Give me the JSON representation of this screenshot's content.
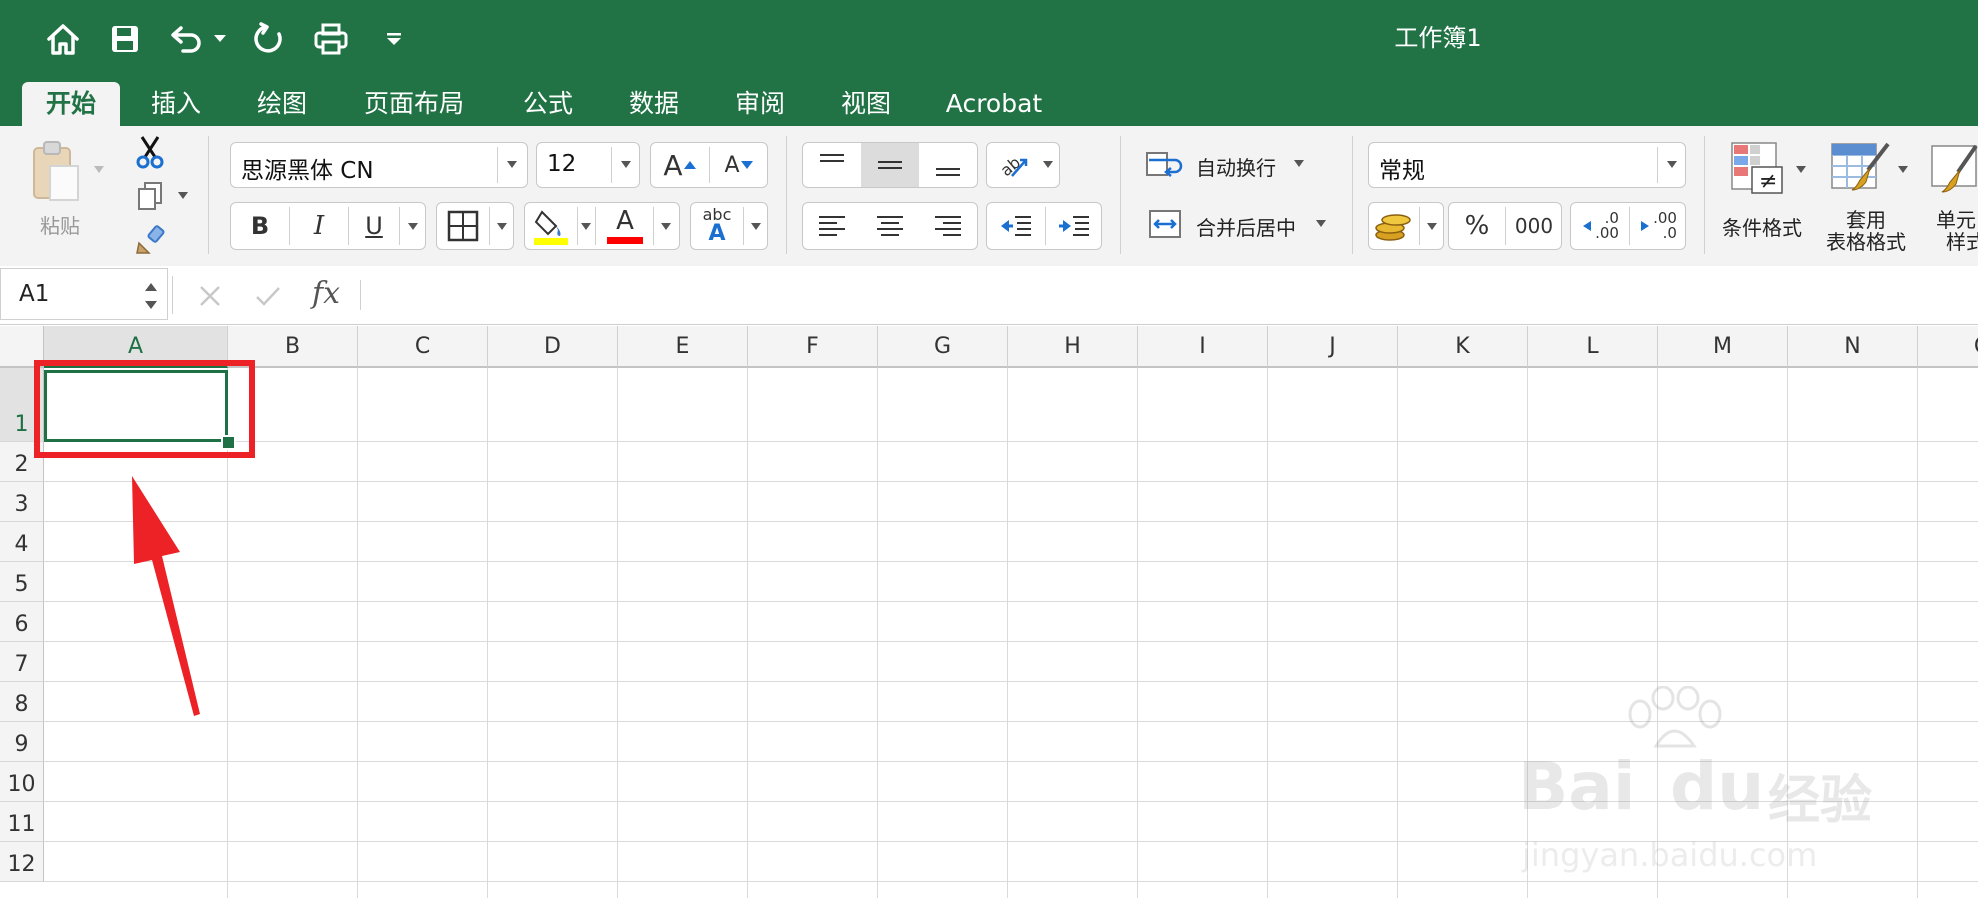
{
  "window": {
    "title": "工作簿1"
  },
  "quick_access": {
    "icons": [
      "home-icon",
      "save-icon",
      "undo-icon",
      "undo-dropdown-icon",
      "redo-icon",
      "print-icon",
      "customize-qat-icon"
    ]
  },
  "tabs": [
    {
      "label": "开始",
      "active": true
    },
    {
      "label": "插入"
    },
    {
      "label": "绘图"
    },
    {
      "label": "页面布局"
    },
    {
      "label": "公式"
    },
    {
      "label": "数据"
    },
    {
      "label": "审阅"
    },
    {
      "label": "视图"
    },
    {
      "label": "Acrobat"
    }
  ],
  "ribbon": {
    "clipboard": {
      "paste_label": "粘贴"
    },
    "font": {
      "name": "思源黑体 CN",
      "size": "12",
      "bold": "B",
      "italic": "I",
      "underline": "U",
      "font_color_glyph": "A",
      "grow_glyph": "A",
      "shrink_glyph": "A",
      "phonetic_top": "abc",
      "phonetic_bottom": "A",
      "fill_color": "#ffff00",
      "font_color": "#ff0000"
    },
    "alignment": {
      "wrap_label": "自动换行",
      "merge_label": "合并后居中"
    },
    "number": {
      "format": "常规",
      "percent": "%",
      "thousands": "000",
      "inc_decimal_top": ".0",
      "inc_decimal_bottom": ".00",
      "dec_decimal_top": ".00",
      "dec_decimal_bottom": ".0"
    },
    "styles": {
      "conditional_label": "条件格式",
      "table_label_1": "套用",
      "table_label_2": "表格格式",
      "cell_label_1": "单元",
      "cell_label_2": "样式"
    }
  },
  "formula_bar": {
    "name_box": "A1",
    "fx_label": "fx",
    "formula": ""
  },
  "sheet": {
    "columns": [
      "A",
      "B",
      "C",
      "D",
      "E",
      "F",
      "G",
      "H",
      "I",
      "J",
      "K",
      "L",
      "M",
      "N",
      "O"
    ],
    "rows": [
      "1",
      "2",
      "3",
      "4",
      "5",
      "6",
      "7",
      "8",
      "9",
      "10",
      "11",
      "12"
    ],
    "selected_cell": "A1"
  },
  "watermark": {
    "line1": "Bai",
    "line2": "du",
    "line3": "经验",
    "url": "jingyan.baidu.com"
  },
  "colors": {
    "excel_green": "#217346",
    "annotation_red": "#ec2227",
    "ribbon_bg": "#f3f3f3",
    "selection_green": "#1e7145"
  }
}
